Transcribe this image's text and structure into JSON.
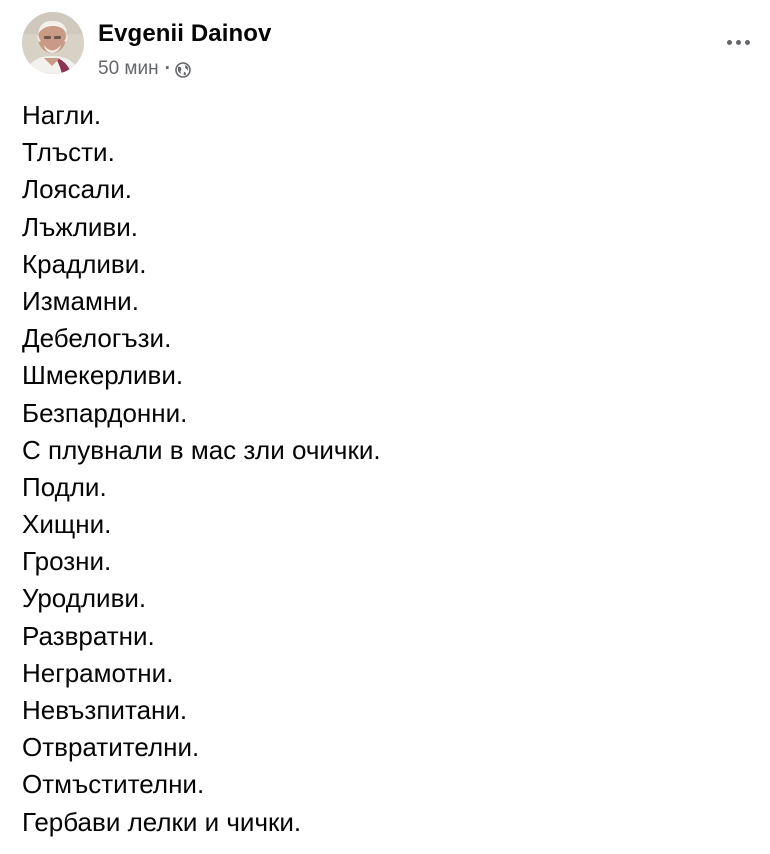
{
  "post": {
    "author": "Evgenii Dainov",
    "time": "50 мин",
    "separator": "·",
    "privacy_icon": "globe-icon",
    "more_icon": "more-options-icon",
    "lines": [
      "Нагли.",
      "Тлъсти.",
      "Лоясали.",
      "Лъжливи.",
      "Крадливи.",
      "Измамни.",
      "Дебелогъзи.",
      "Шмекерливи.",
      "Безпардонни.",
      "С плувнали в мас зли очички.",
      "Подли.",
      "Хищни.",
      "Грозни.",
      "Уродливи.",
      "Развратни.",
      "Неграмотни.",
      "Невъзпитани.",
      "Отвратителни.",
      "Отмъстителни.",
      "Гербави лелки и чички."
    ]
  },
  "colors": {
    "text": "#050505",
    "secondary_text": "#65676b",
    "background": "#ffffff"
  }
}
